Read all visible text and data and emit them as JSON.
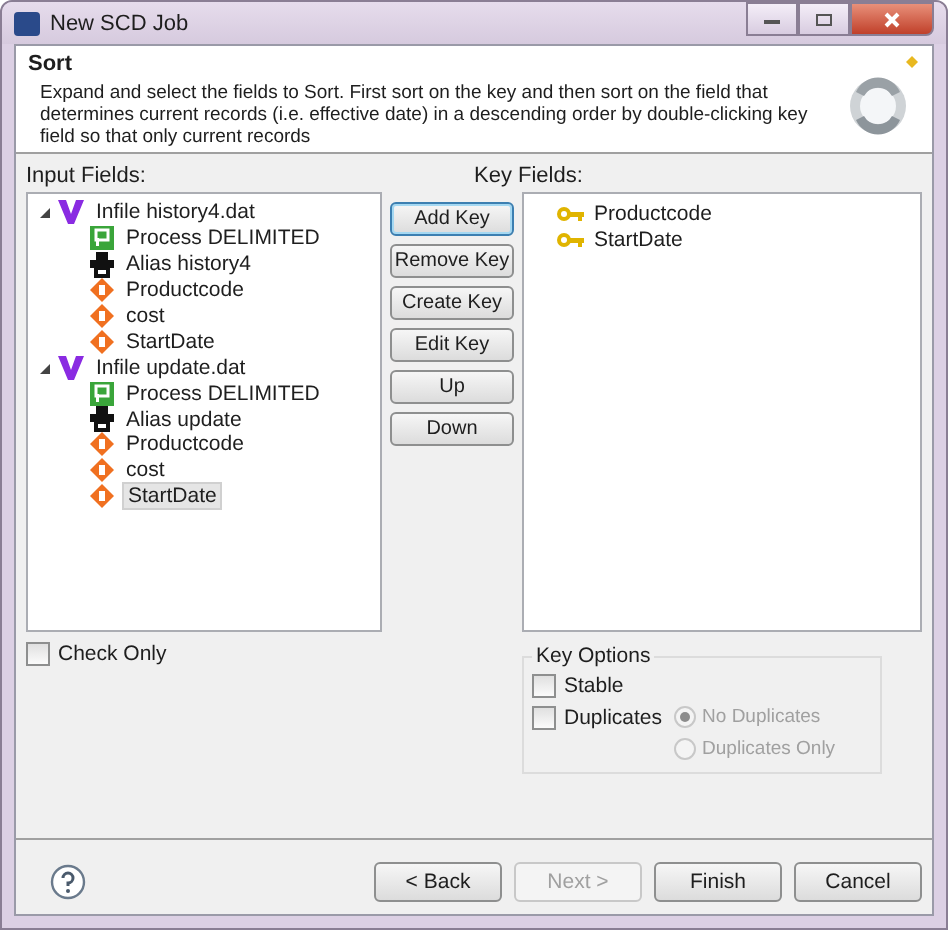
{
  "window": {
    "title": "New SCD Job"
  },
  "header": {
    "title": "Sort",
    "description": "Expand and select the fields to Sort. First sort on the key and then sort on the field that determines current records (i.e. effective date) in a descending order by double-clicking key field so that only current records"
  },
  "input_fields": {
    "label": "Input Fields:",
    "items": [
      {
        "kind": "infile",
        "label": "Infile history4.dat",
        "expanded": true,
        "selected": false,
        "children": [
          {
            "kind": "process",
            "label": "Process DELIMITED",
            "selected": false
          },
          {
            "kind": "alias",
            "label": "Alias history4",
            "selected": false
          },
          {
            "kind": "field",
            "label": "Productcode",
            "selected": false
          },
          {
            "kind": "field",
            "label": "cost",
            "selected": false
          },
          {
            "kind": "field",
            "label": "StartDate",
            "selected": false
          }
        ]
      },
      {
        "kind": "infile",
        "label": "Infile update.dat",
        "expanded": true,
        "selected": false,
        "children": [
          {
            "kind": "process",
            "label": "Process DELIMITED",
            "selected": false
          },
          {
            "kind": "alias",
            "label": "Alias update",
            "selected": false
          },
          {
            "kind": "field",
            "label": "Productcode",
            "selected": false
          },
          {
            "kind": "field",
            "label": "cost",
            "selected": false
          },
          {
            "kind": "field",
            "label": "StartDate",
            "selected": true
          }
        ]
      }
    ]
  },
  "key_buttons": [
    {
      "label": "Add Key",
      "focused": true
    },
    {
      "label": "Remove Key",
      "focused": false
    },
    {
      "label": "Create Key",
      "focused": false
    },
    {
      "label": "Edit Key",
      "focused": false
    },
    {
      "label": "Up",
      "focused": false
    },
    {
      "label": "Down",
      "focused": false
    }
  ],
  "key_fields": {
    "label": "Key Fields:",
    "items": [
      {
        "label": "Productcode"
      },
      {
        "label": "StartDate"
      }
    ]
  },
  "check_only": {
    "label": "Check Only",
    "checked": false
  },
  "key_options": {
    "title": "Key Options",
    "stable": {
      "label": "Stable",
      "checked": false
    },
    "duplicates": {
      "label": "Duplicates",
      "checked": false
    },
    "radios": [
      {
        "label": "No Duplicates",
        "selected": true,
        "disabled": true
      },
      {
        "label": "Duplicates Only",
        "selected": false,
        "disabled": true
      }
    ]
  },
  "footer": {
    "buttons": [
      {
        "label": "< Back",
        "disabled": false
      },
      {
        "label": "Next >",
        "disabled": true
      },
      {
        "label": "Finish",
        "disabled": false
      },
      {
        "label": "Cancel",
        "disabled": false
      }
    ]
  }
}
